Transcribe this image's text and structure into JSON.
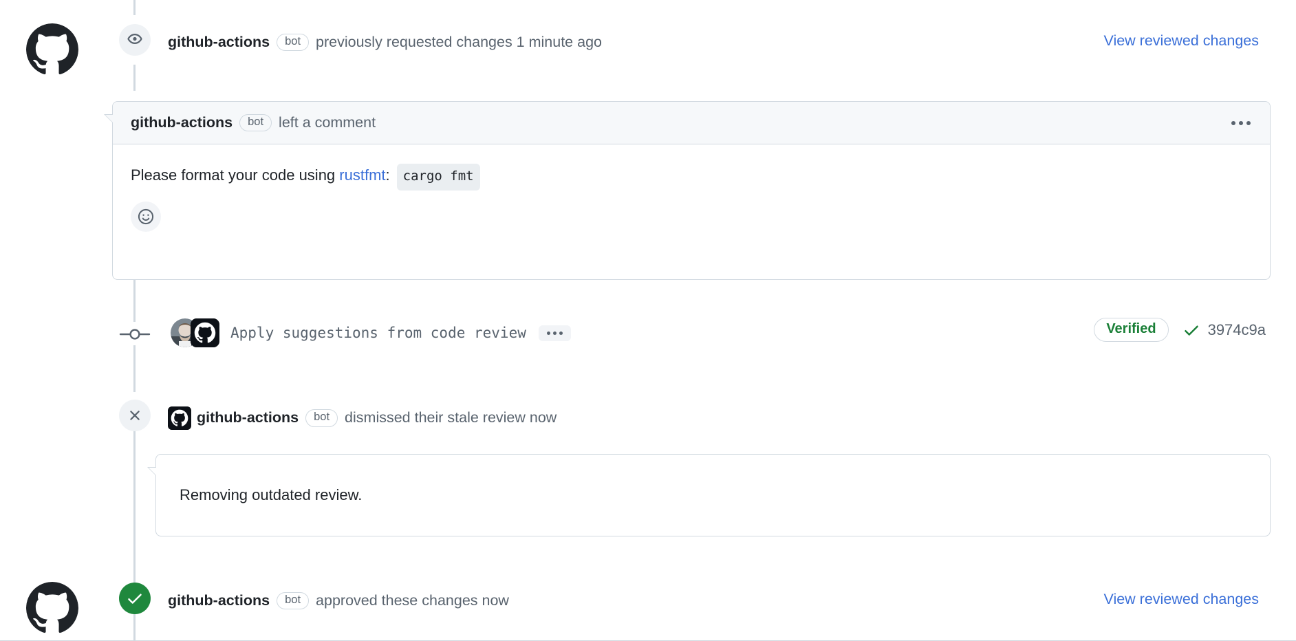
{
  "theme": {
    "accent_link": "#3a6fd8",
    "success_green": "#1f883d",
    "verified_green": "#1a7f37",
    "muted_text": "#59636e",
    "body_text": "#1f2328",
    "border": "#d1d9e0",
    "header_bg": "#f6f8fa",
    "badge_bg": "#eff2f5"
  },
  "events": [
    {
      "id": "requested-changes",
      "icon": "eye-icon",
      "actor": "github-actions",
      "bot_label": "bot",
      "action": "previously requested changes",
      "time": "1 minute ago",
      "action_full": "previously requested changes 1 minute ago",
      "link_label": "View reviewed changes"
    },
    {
      "id": "dismissed-review",
      "icon": "x-icon",
      "actor": "github-actions",
      "bot_label": "bot",
      "action": "dismissed their stale review",
      "time": "now",
      "action_full": "dismissed their stale review now",
      "note": "Removing outdated review."
    },
    {
      "id": "approved-changes",
      "icon": "check-icon",
      "actor": "github-actions",
      "bot_label": "bot",
      "action": "approved these changes",
      "time": "now",
      "action_full": "approved these changes now",
      "link_label": "View reviewed changes"
    }
  ],
  "comment": {
    "actor": "github-actions",
    "bot_label": "bot",
    "header_action": "left a comment",
    "body_prefix": "Please format your code using ",
    "body_link": "rustfmt",
    "body_suffix": ":",
    "body_code": "cargo fmt",
    "menu_icon": "kebab-menu-icon",
    "reaction_icon": "smiley-reaction-icon"
  },
  "commit": {
    "icon": "commit-node-icon",
    "message": "Apply suggestions from code review",
    "menu_icon": "kebab-menu-icon",
    "verified_label": "Verified",
    "check_icon": "check-mark-icon",
    "sha": "3974c9a"
  }
}
